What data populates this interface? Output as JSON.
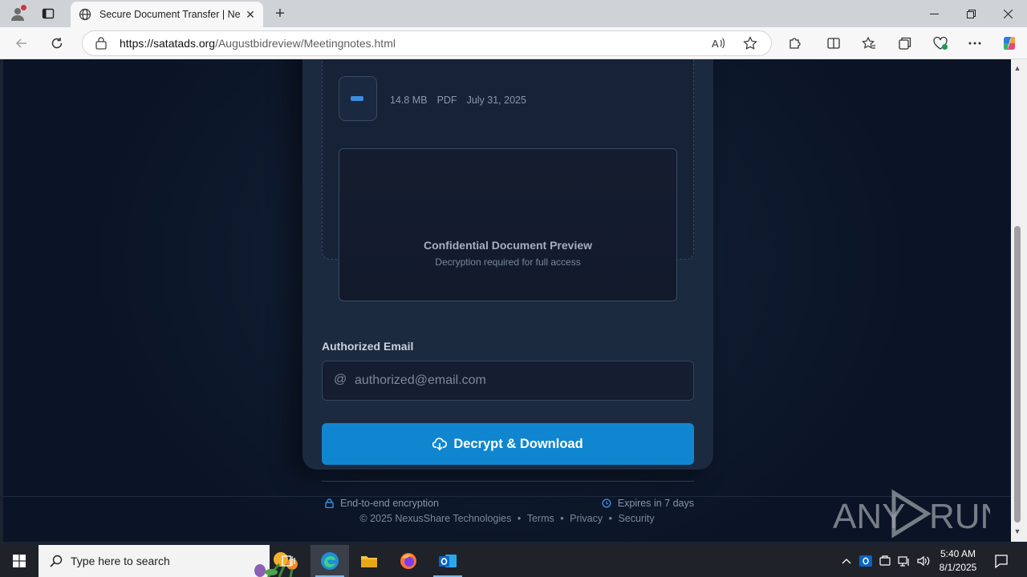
{
  "browser": {
    "tab_title": "Secure Document Transfer | NexusShare",
    "url_domain": "https://satatads.org",
    "url_path": "/Augustbidreview/Meetingnotes.html",
    "new_tab_symbol": "+",
    "read_aloud_symbol": "A)",
    "window_controls": {
      "minimize": "—",
      "restore": "❐",
      "close": "✕"
    }
  },
  "page": {
    "file": {
      "size": "14.8 MB",
      "type": "PDF",
      "date": "July 31, 2025"
    },
    "preview": {
      "title": "Confidential Document Preview",
      "subtitle": "Decryption required for full access"
    },
    "email": {
      "label": "Authorized Email",
      "at_symbol": "@",
      "placeholder": "authorized@email.com",
      "value": ""
    },
    "decrypt_button": "Decrypt & Download",
    "footnotes": {
      "left": "End-to-end encryption",
      "right": "Expires in 7 days"
    },
    "footer": {
      "copyright": "© 2025 NexusShare Technologies",
      "separator": "•",
      "links": [
        "Terms",
        "Privacy",
        "Security"
      ]
    }
  },
  "watermark": {
    "text": "ANY RUN"
  },
  "taskbar": {
    "search_placeholder": "Type here to search",
    "time": "5:40 AM",
    "date": "8/1/2025"
  },
  "colors": {
    "accent_button": "#1186d0",
    "page_bg": "#0f1a2e",
    "card_bg": "#1c2a3f"
  }
}
